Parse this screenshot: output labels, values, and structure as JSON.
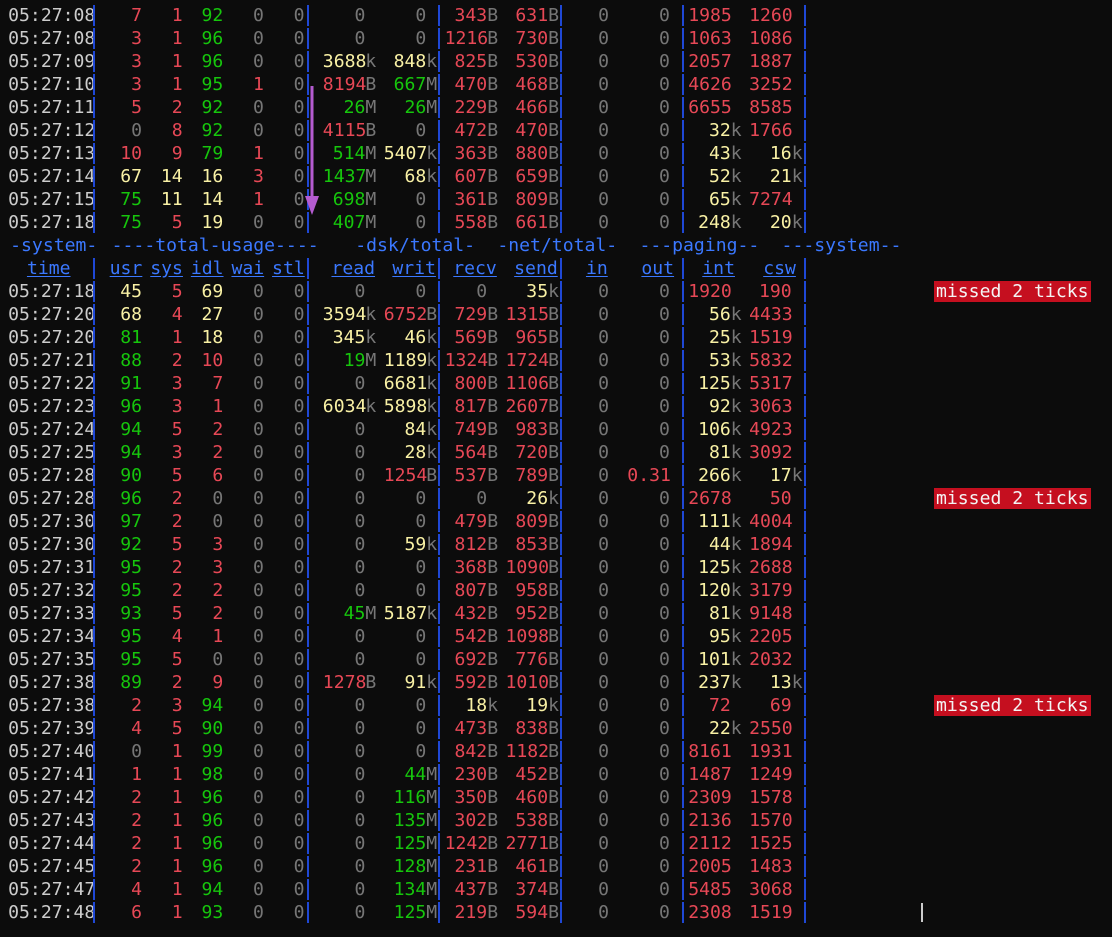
{
  "colors": {
    "time": "#cccccc",
    "red": "#e74856",
    "green": "#16c60c",
    "yellow": "#f9f1a5",
    "dim": "#767676",
    "white": "#cccccc",
    "blue": "#3b78ff",
    "separator": "#1f48d6",
    "badge_bg": "#c50f1f",
    "badge_fg": "#f4f4f4",
    "arrow": "#b45bd0"
  },
  "headers": {
    "groups": [
      "-system-",
      "----total-usage----",
      "-dsk/total-",
      "-net/total-",
      "---paging--",
      "---system--"
    ],
    "columns": [
      "time",
      "usr",
      "sys",
      "idl",
      "wai",
      "stl",
      "read",
      "writ",
      "recv",
      "send",
      "in",
      "out",
      "int",
      "csw"
    ]
  },
  "arrow_icon": "down-arrow-annotation",
  "top_rows": [
    [
      "05:27:08",
      "7",
      "1",
      "92",
      "0",
      "0",
      "0",
      "0",
      "343B",
      "631B",
      "0",
      "0",
      "1985",
      "1260",
      ""
    ],
    [
      "05:27:08",
      "3",
      "1",
      "96",
      "0",
      "0",
      "0",
      "0",
      "1216B",
      "730B",
      "0",
      "0",
      "1063",
      "1086",
      ""
    ],
    [
      "05:27:09",
      "3",
      "1",
      "96",
      "0",
      "0",
      "3688k",
      "848k",
      "825B",
      "530B",
      "0",
      "0",
      "2057",
      "1887",
      ""
    ],
    [
      "05:27:10",
      "3",
      "1",
      "95",
      "1",
      "0",
      "8194B",
      "667M",
      "470B",
      "468B",
      "0",
      "0",
      "4626",
      "3252",
      ""
    ],
    [
      "05:27:11",
      "5",
      "2",
      "92",
      "0",
      "0",
      "26M",
      "26M",
      "229B",
      "466B",
      "0",
      "0",
      "6655",
      "8585",
      ""
    ],
    [
      "05:27:12",
      "0",
      "8",
      "92",
      "0",
      "0",
      "4115B",
      "0",
      "472B",
      "470B",
      "0",
      "0",
      "32k",
      "1766",
      ""
    ],
    [
      "05:27:13",
      "10",
      "9",
      "79",
      "1",
      "0",
      "514M",
      "5407k",
      "363B",
      "880B",
      "0",
      "0",
      "43k",
      "16k",
      ""
    ],
    [
      "05:27:14",
      "67",
      "14",
      "16",
      "3",
      "0",
      "1437M",
      "68k",
      "607B",
      "659B",
      "0",
      "0",
      "52k",
      "21k",
      ""
    ],
    [
      "05:27:15",
      "75",
      "11",
      "14",
      "1",
      "0",
      "698M",
      "0",
      "361B",
      "809B",
      "0",
      "0",
      "65k",
      "7274",
      ""
    ],
    [
      "05:27:18",
      "75",
      "5",
      "19",
      "0",
      "0",
      "407M",
      "0",
      "558B",
      "661B",
      "0",
      "0",
      "248k",
      "20k",
      ""
    ]
  ],
  "bottom_rows": [
    [
      "05:27:18",
      "45",
      "5",
      "69",
      "0",
      "0",
      "0",
      "0",
      "0",
      "35k",
      "0",
      "0",
      "1920",
      "190",
      "missed 2 ticks"
    ],
    [
      "05:27:20",
      "68",
      "4",
      "27",
      "0",
      "0",
      "3594k",
      "6752B",
      "729B",
      "1315B",
      "0",
      "0",
      "56k",
      "4433",
      ""
    ],
    [
      "05:27:20",
      "81",
      "1",
      "18",
      "0",
      "0",
      "345k",
      "46k",
      "569B",
      "965B",
      "0",
      "0",
      "25k",
      "1519",
      ""
    ],
    [
      "05:27:21",
      "88",
      "2",
      "10",
      "0",
      "0",
      "19M",
      "1189k",
      "1324B",
      "1724B",
      "0",
      "0",
      "53k",
      "5832",
      ""
    ],
    [
      "05:27:22",
      "91",
      "3",
      "7",
      "0",
      "0",
      "0",
      "6681k",
      "800B",
      "1106B",
      "0",
      "0",
      "125k",
      "5317",
      ""
    ],
    [
      "05:27:23",
      "96",
      "3",
      "1",
      "0",
      "0",
      "6034k",
      "5898k",
      "817B",
      "2607B",
      "0",
      "0",
      "92k",
      "3063",
      ""
    ],
    [
      "05:27:24",
      "94",
      "5",
      "2",
      "0",
      "0",
      "0",
      "84k",
      "749B",
      "983B",
      "0",
      "0",
      "106k",
      "4923",
      ""
    ],
    [
      "05:27:25",
      "94",
      "3",
      "2",
      "0",
      "0",
      "0",
      "28k",
      "564B",
      "720B",
      "0",
      "0",
      "81k",
      "3092",
      ""
    ],
    [
      "05:27:28",
      "90",
      "5",
      "6",
      "0",
      "0",
      "0",
      "1254B",
      "537B",
      "789B",
      "0",
      "0.31",
      "266k",
      "17k",
      ""
    ],
    [
      "05:27:28",
      "96",
      "2",
      "0",
      "0",
      "0",
      "0",
      "0",
      "0",
      "26k",
      "0",
      "0",
      "2678",
      "50",
      "missed 2 ticks"
    ],
    [
      "05:27:30",
      "97",
      "2",
      "0",
      "0",
      "0",
      "0",
      "0",
      "479B",
      "809B",
      "0",
      "0",
      "111k",
      "4004",
      ""
    ],
    [
      "05:27:30",
      "92",
      "5",
      "3",
      "0",
      "0",
      "0",
      "59k",
      "812B",
      "853B",
      "0",
      "0",
      "44k",
      "1894",
      ""
    ],
    [
      "05:27:31",
      "95",
      "2",
      "3",
      "0",
      "0",
      "0",
      "0",
      "368B",
      "1090B",
      "0",
      "0",
      "125k",
      "2688",
      ""
    ],
    [
      "05:27:32",
      "95",
      "2",
      "2",
      "0",
      "0",
      "0",
      "0",
      "807B",
      "958B",
      "0",
      "0",
      "120k",
      "3179",
      ""
    ],
    [
      "05:27:33",
      "93",
      "5",
      "2",
      "0",
      "0",
      "45M",
      "5187k",
      "432B",
      "952B",
      "0",
      "0",
      "81k",
      "9148",
      ""
    ],
    [
      "05:27:34",
      "95",
      "4",
      "1",
      "0",
      "0",
      "0",
      "0",
      "542B",
      "1098B",
      "0",
      "0",
      "95k",
      "2205",
      ""
    ],
    [
      "05:27:35",
      "95",
      "5",
      "0",
      "0",
      "0",
      "0",
      "0",
      "692B",
      "776B",
      "0",
      "0",
      "101k",
      "2032",
      ""
    ],
    [
      "05:27:38",
      "89",
      "2",
      "9",
      "0",
      "0",
      "1278B",
      "91k",
      "592B",
      "1010B",
      "0",
      "0",
      "237k",
      "13k",
      ""
    ],
    [
      "05:27:38",
      "2",
      "3",
      "94",
      "0",
      "0",
      "0",
      "0",
      "18k",
      "19k",
      "0",
      "0",
      "72",
      "69",
      "missed 2 ticks"
    ],
    [
      "05:27:39",
      "4",
      "5",
      "90",
      "0",
      "0",
      "0",
      "0",
      "473B",
      "838B",
      "0",
      "0",
      "22k",
      "2550",
      ""
    ],
    [
      "05:27:40",
      "0",
      "1",
      "99",
      "0",
      "0",
      "0",
      "0",
      "842B",
      "1182B",
      "0",
      "0",
      "8161",
      "1931",
      ""
    ],
    [
      "05:27:41",
      "1",
      "1",
      "98",
      "0",
      "0",
      "0",
      "44M",
      "230B",
      "452B",
      "0",
      "0",
      "1487",
      "1249",
      ""
    ],
    [
      "05:27:42",
      "2",
      "1",
      "96",
      "0",
      "0",
      "0",
      "116M",
      "350B",
      "460B",
      "0",
      "0",
      "2309",
      "1578",
      ""
    ],
    [
      "05:27:43",
      "2",
      "1",
      "96",
      "0",
      "0",
      "0",
      "135M",
      "302B",
      "538B",
      "0",
      "0",
      "2136",
      "1570",
      ""
    ],
    [
      "05:27:44",
      "2",
      "1",
      "96",
      "0",
      "0",
      "0",
      "125M",
      "1242B",
      "2771B",
      "0",
      "0",
      "2112",
      "1525",
      ""
    ],
    [
      "05:27:45",
      "2",
      "1",
      "96",
      "0",
      "0",
      "0",
      "128M",
      "231B",
      "461B",
      "0",
      "0",
      "2005",
      "1483",
      ""
    ],
    [
      "05:27:47",
      "4",
      "1",
      "94",
      "0",
      "0",
      "0",
      "134M",
      "437B",
      "374B",
      "0",
      "0",
      "5485",
      "3068",
      ""
    ],
    [
      "05:27:48",
      "6",
      "1",
      "93",
      "0",
      "0",
      "0",
      "125M",
      "219B",
      "594B",
      "0",
      "0",
      "2308",
      "1519",
      ""
    ]
  ]
}
